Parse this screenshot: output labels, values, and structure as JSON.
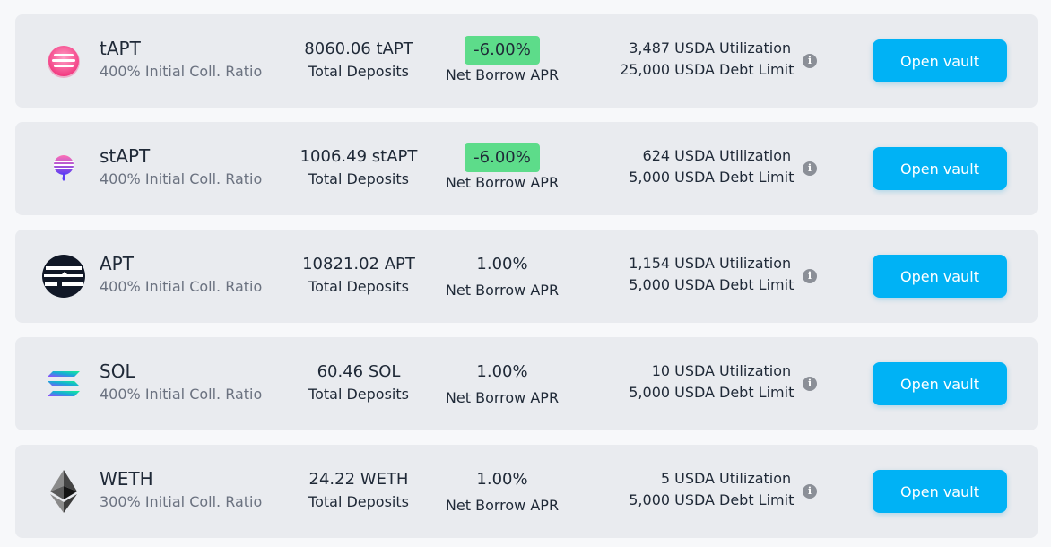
{
  "colors": {
    "accent": "#00b2f5",
    "apr_negative_badge": "#5ddc8a",
    "card_bg": "#e9ebef"
  },
  "vaults": [
    {
      "name": "tAPT",
      "icon": "tapt-logo-icon",
      "ratio": "400% Initial Coll. Ratio",
      "deposits": "8060.06 tAPT",
      "deposits_label": "Total Deposits",
      "apr": "-6.00%",
      "apr_badge": true,
      "apr_label": "Net Borrow APR",
      "utilization": "3,487 USDA",
      "utilization_label": "Utilization",
      "debt_limit": "25,000 USDA",
      "debt_limit_label": "Debt Limit",
      "button": "Open vault"
    },
    {
      "name": "stAPT",
      "icon": "stapt-logo-icon",
      "ratio": "400% Initial Coll. Ratio",
      "deposits": "1006.49 stAPT",
      "deposits_label": "Total Deposits",
      "apr": "-6.00%",
      "apr_badge": true,
      "apr_label": "Net Borrow APR",
      "utilization": "624 USDA",
      "utilization_label": "Utilization",
      "debt_limit": "5,000 USDA",
      "debt_limit_label": "Debt Limit",
      "button": "Open vault"
    },
    {
      "name": "APT",
      "icon": "apt-logo-icon",
      "ratio": "400% Initial Coll. Ratio",
      "deposits": "10821.02 APT",
      "deposits_label": "Total Deposits",
      "apr": "1.00%",
      "apr_badge": false,
      "apr_label": "Net Borrow APR",
      "utilization": "1,154 USDA",
      "utilization_label": "Utilization",
      "debt_limit": "5,000 USDA",
      "debt_limit_label": "Debt Limit",
      "button": "Open vault"
    },
    {
      "name": "SOL",
      "icon": "sol-logo-icon",
      "ratio": "400% Initial Coll. Ratio",
      "deposits": "60.46 SOL",
      "deposits_label": "Total Deposits",
      "apr": "1.00%",
      "apr_badge": false,
      "apr_label": "Net Borrow APR",
      "utilization": "10 USDA",
      "utilization_label": "Utilization",
      "debt_limit": "5,000 USDA",
      "debt_limit_label": "Debt Limit",
      "button": "Open vault"
    },
    {
      "name": "WETH",
      "icon": "weth-logo-icon",
      "ratio": "300% Initial Coll. Ratio",
      "deposits": "24.22 WETH",
      "deposits_label": "Total Deposits",
      "apr": "1.00%",
      "apr_badge": false,
      "apr_label": "Net Borrow APR",
      "utilization": "5 USDA",
      "utilization_label": "Utilization",
      "debt_limit": "5,000 USDA",
      "debt_limit_label": "Debt Limit",
      "button": "Open vault"
    }
  ]
}
